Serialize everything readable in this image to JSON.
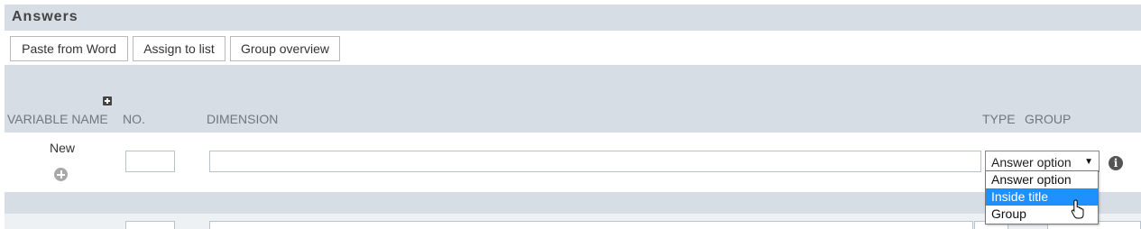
{
  "panel": {
    "title": "Answers"
  },
  "toolbar": {
    "paste_label": "Paste from Word",
    "assign_label": "Assign to list",
    "group_label": "Group overview"
  },
  "columns": {
    "variable_name": "VARIABLE NAME",
    "no": "NO.",
    "dimension": "DIMENSION",
    "type": "TYPE",
    "group": "GROUP"
  },
  "new_row": {
    "label": "New",
    "no_value": "",
    "dimension_value": "",
    "type_selected": "Answer option"
  },
  "type_dropdown": {
    "options": [
      "Answer option",
      "Inside title",
      "Group"
    ],
    "highlighted": "Inside title"
  },
  "icons": {
    "expand": "expand-plus-icon",
    "add": "add-circle-icon",
    "info": "info-icon",
    "arrow": "dropdown-arrow-icon",
    "cursor": "mouse-pointer-icon"
  },
  "colors": {
    "header_bg": "#d6dde4",
    "highlight": "#1e90ff",
    "column_label": "#707780"
  }
}
